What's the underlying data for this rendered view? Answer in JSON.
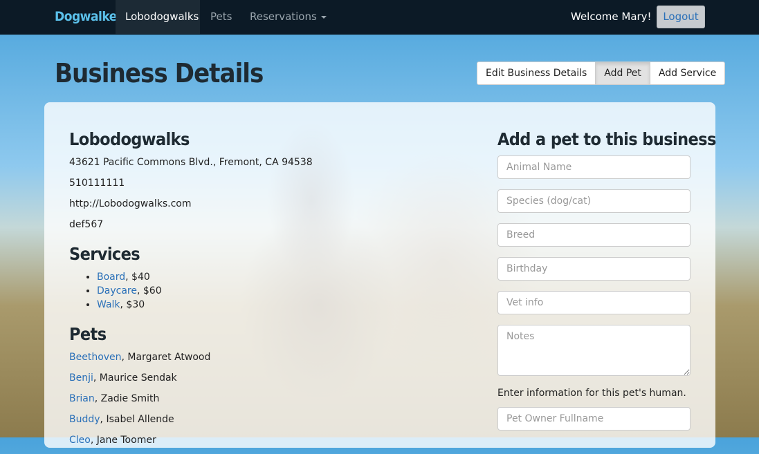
{
  "nav": {
    "brand": "Dogwalker",
    "items": [
      {
        "label": "Lobodogwalks"
      },
      {
        "label": "Pets"
      },
      {
        "label": "Reservations"
      }
    ],
    "welcome": "Welcome Mary!",
    "logout": "Logout"
  },
  "header": {
    "title": "Business Details",
    "buttons": [
      {
        "label": "Edit Business Details"
      },
      {
        "label": "Add Pet",
        "active": true
      },
      {
        "label": "Add Service"
      }
    ]
  },
  "business": {
    "name": "Lobodogwalks",
    "address": "43621 Pacific Commons Blvd., Fremont, CA 94538",
    "phone": "510111111",
    "website": "http://Lobodogwalks.com",
    "code": "def567"
  },
  "services": {
    "heading": "Services",
    "items": [
      {
        "name": "Board",
        "price": ", $40"
      },
      {
        "name": "Daycare",
        "price": ", $60"
      },
      {
        "name": "Walk",
        "price": ", $30"
      }
    ]
  },
  "pets": {
    "heading": "Pets",
    "items": [
      {
        "name": "Beethoven",
        "owner": ", Margaret Atwood"
      },
      {
        "name": "Benji",
        "owner": ", Maurice Sendak"
      },
      {
        "name": "Brian",
        "owner": ", Zadie Smith"
      },
      {
        "name": "Buddy",
        "owner": ", Isabel Allende"
      },
      {
        "name": "Cleo",
        "owner": ", Jane Toomer"
      }
    ]
  },
  "form": {
    "heading": "Add a pet to this business",
    "placeholders": {
      "animal_name": "Animal Name",
      "species": "Species (dog/cat)",
      "breed": "Breed",
      "birthday": "Birthday",
      "vet_info": "Vet info",
      "notes": "Notes",
      "owner_fullname": "Pet Owner Fullname"
    },
    "owner_note": "Enter information for this pet's human."
  },
  "colors": {
    "navbar": "#0c1a26",
    "brand": "#5bc0ea",
    "link": "#2a70b8"
  }
}
